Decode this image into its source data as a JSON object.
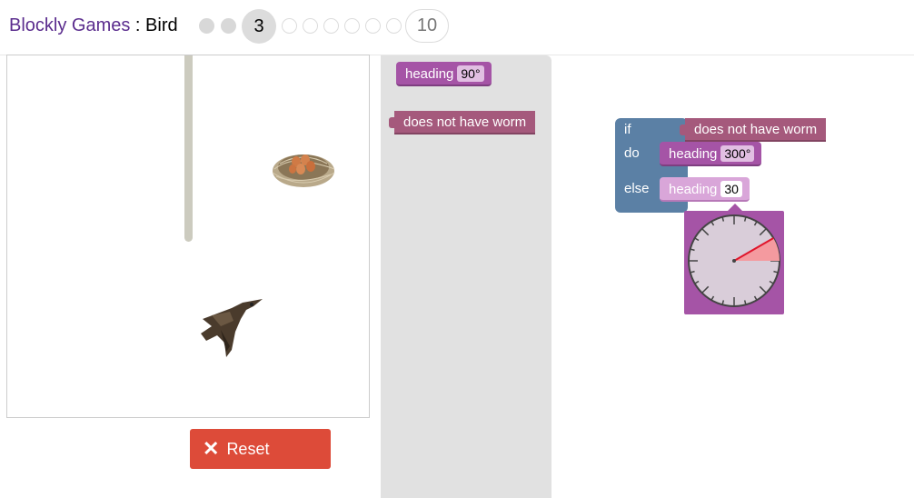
{
  "header": {
    "app_name": "Blockly Games",
    "separator": " : ",
    "game_name": "Bird",
    "levels": [
      {
        "label": "",
        "state": "done"
      },
      {
        "label": "",
        "state": "done"
      },
      {
        "label": "3",
        "state": "current"
      },
      {
        "label": "",
        "state": "todo"
      },
      {
        "label": "",
        "state": "todo"
      },
      {
        "label": "",
        "state": "todo"
      },
      {
        "label": "",
        "state": "todo"
      },
      {
        "label": "",
        "state": "todo"
      },
      {
        "label": "",
        "state": "todo"
      },
      {
        "label": "10",
        "state": "last"
      }
    ]
  },
  "controls": {
    "reset_label": "Reset",
    "reset_icon": "close-icon"
  },
  "toolbox": {
    "heading_label": "heading",
    "heading_value": "90°",
    "condition_label": "does not have worm"
  },
  "workspace": {
    "if_label": "if",
    "do_label": "do",
    "else_label": "else",
    "condition_label": "does not have worm",
    "do_heading_label": "heading",
    "do_heading_value": "300°",
    "else_heading_label": "heading",
    "else_heading_value": "30"
  },
  "dial": {
    "angle_degrees": 30
  },
  "colors": {
    "brand_purple": "#5b2d8e",
    "reset_red": "#dd4b39",
    "heading_block": "#a554a6",
    "condition_block": "#a5597c",
    "logic_block": "#5b80a5",
    "wall": "#cccbbf"
  }
}
